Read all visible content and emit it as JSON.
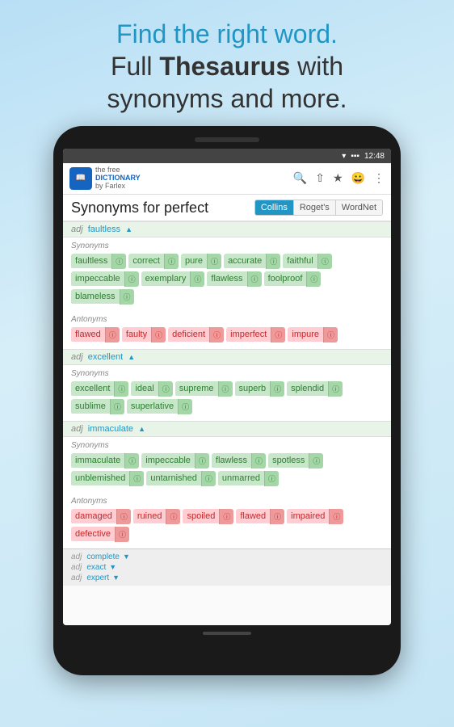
{
  "header": {
    "line1a": "Find the right word.",
    "line2a": "Full ",
    "line2b": "Thesaurus",
    "line2c": " with",
    "line3": "synonyms and more."
  },
  "statusBar": {
    "wifi": "▾",
    "signal": "▪▪▪",
    "time": "12:48"
  },
  "toolbar": {
    "logoText1": "the free",
    "logoText2": "DICTIONARY",
    "logoText3": "by Farlex",
    "icons": [
      "🔍",
      "⇧",
      "★",
      "😀",
      "⋮"
    ]
  },
  "titleRow": {
    "title": "Synonyms for perfect",
    "tabs": [
      {
        "label": "Collins",
        "active": true
      },
      {
        "label": "Roget's",
        "active": false
      },
      {
        "label": "WordNet",
        "active": false
      }
    ]
  },
  "sections": [
    {
      "id": "faultless",
      "adjLabel": "adj",
      "word": "faultless",
      "arrow": "▲",
      "synonymsLabel": "Synonyms",
      "synonyms": [
        "faultless",
        "correct",
        "pure",
        "accurate",
        "faithful",
        "impeccable",
        "exemplary",
        "flawless",
        "foolproof",
        "blameless"
      ],
      "antonymsLabel": "Antonyms",
      "antonyms": [
        "flawed",
        "faulty",
        "deficient",
        "imperfect",
        "impure"
      ]
    },
    {
      "id": "excellent",
      "adjLabel": "adj",
      "word": "excellent",
      "arrow": "▲",
      "synonymsLabel": "Synonyms",
      "synonyms": [
        "excellent",
        "ideal",
        "supreme",
        "superb",
        "splendid",
        "sublime",
        "superlative"
      ],
      "antonymsLabel": null,
      "antonyms": []
    },
    {
      "id": "immaculate",
      "adjLabel": "adj",
      "word": "immaculate",
      "arrow": "▲",
      "synonymsLabel": "Synonyms",
      "synonyms": [
        "immaculate",
        "impeccable",
        "flawless",
        "spotless",
        "unblemished",
        "untarnished",
        "unmarred"
      ],
      "antonymsLabel": "Antonyms",
      "antonyms": [
        "damaged",
        "ruined",
        "spoiled",
        "flawed",
        "impaired",
        "defective"
      ]
    }
  ],
  "bottomNav": [
    {
      "adjLabel": "adj",
      "word": "complete",
      "arrow": "▼"
    },
    {
      "adjLabel": "adj",
      "word": "exact",
      "arrow": "▼"
    },
    {
      "adjLabel": "adj",
      "word": "expert",
      "arrow": "▼"
    }
  ]
}
